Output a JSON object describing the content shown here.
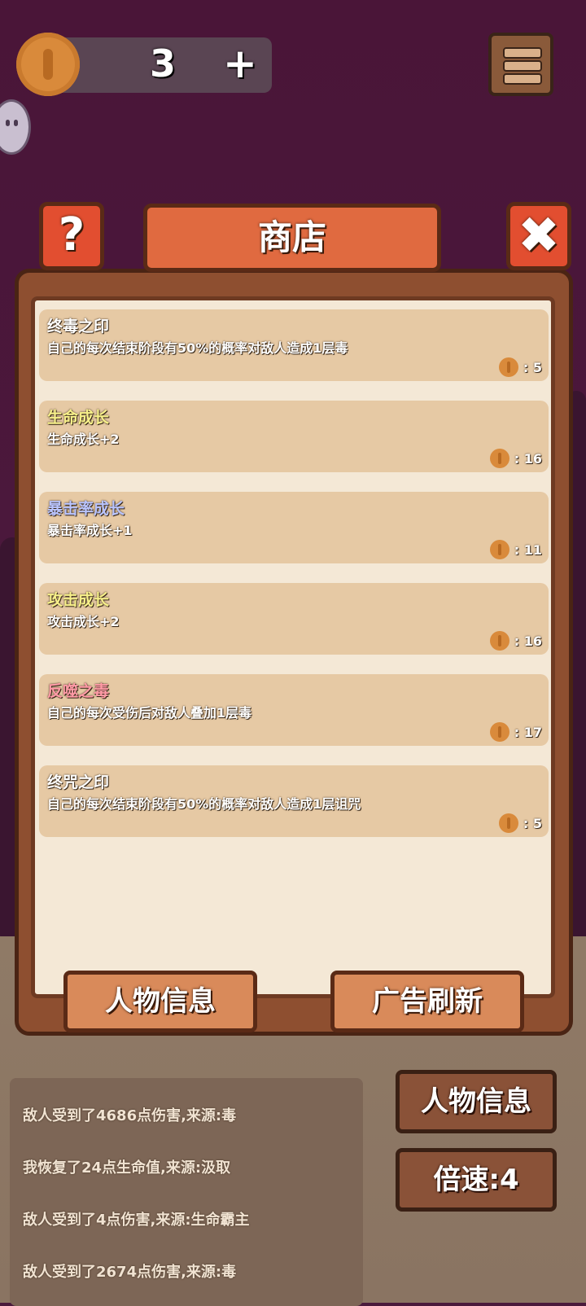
{
  "hud": {
    "coins": "3",
    "add_symbol": "+",
    "menu_icon": "hamburger-menu-icon"
  },
  "shop": {
    "title": "商店",
    "help_symbol": "?",
    "close_symbol": "✖",
    "items": [
      {
        "name": "终毒之印",
        "desc": "自己的每次结束阶段有50%的概率对敌人造成1层毒",
        "price": ": 5",
        "name_color": "#ffffff"
      },
      {
        "name": "生命成长",
        "desc": "生命成长+2",
        "price": ": 16",
        "name_color": "#f7f08a"
      },
      {
        "name": "暴击率成长",
        "desc": "暴击率成长+1",
        "price": ": 11",
        "name_color": "#b9c4ff"
      },
      {
        "name": "攻击成长",
        "desc": "攻击成长+2",
        "price": ": 16",
        "name_color": "#f7f08a"
      },
      {
        "name": "反噬之毒",
        "desc": "自己的每次受伤后对敌人叠加1层毒",
        "price": ": 17",
        "name_color": "#ff9aa6"
      },
      {
        "name": "终咒之印",
        "desc": "自己的每次结束阶段有50%的概率对敌人造成1层诅咒",
        "price": ": 5",
        "name_color": "#ffffff"
      }
    ],
    "character_info_label": "人物信息",
    "ad_refresh_label": "广告刷新"
  },
  "battle_log": [
    "敌人受到了4686点伤害,来源:毒",
    "我恢复了24点生命值,来源:汲取",
    "敌人受到了4点伤害,来源:生命霸主",
    "敌人受到了2674点伤害,来源:毒"
  ],
  "side_buttons": {
    "character_info_label": "人物信息",
    "speed_label": "倍速:4"
  }
}
